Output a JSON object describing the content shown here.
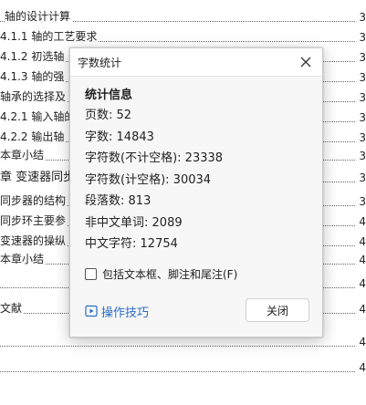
{
  "document": {
    "toc": [
      {
        "text": "轴的设计计算",
        "page": "3"
      },
      {
        "text": "4.1.1 轴的工艺要求",
        "page": "3"
      },
      {
        "text": "4.1.2 初选轴",
        "page": "3"
      },
      {
        "text": "4.1.3 轴的强",
        "page": "3"
      },
      {
        "text": "轴承的选择及",
        "page": "3"
      },
      {
        "text": "4.2.1 输入轴的",
        "page": "3"
      },
      {
        "text": "4.2.2 输出轴",
        "page": "3"
      },
      {
        "text": "本章小结",
        "page": "3"
      },
      {
        "text": "章 变速器同步",
        "page": "3"
      },
      {
        "text": "同步器的结构",
        "page": "3"
      },
      {
        "text": "同步环主要参",
        "page": "4"
      },
      {
        "text": "变速器的操纵",
        "page": "4"
      },
      {
        "text": "本章小结",
        "page": "4"
      },
      {
        "text": "",
        "page": "4"
      },
      {
        "text": "文献",
        "page": "4"
      },
      {
        "text": "",
        "page": "4"
      },
      {
        "text": "",
        "page": "4"
      }
    ]
  },
  "dialog": {
    "title": "字数统计",
    "section_title": "统计信息",
    "stats": [
      {
        "label": "页数:",
        "value": "52"
      },
      {
        "label": "字数:",
        "value": "14843"
      },
      {
        "label": "字符数(不计空格):",
        "value": "23338"
      },
      {
        "label": "字符数(计空格):",
        "value": "30034"
      },
      {
        "label": "段落数:",
        "value": "813"
      },
      {
        "label": "非中文单词:",
        "value": "2089"
      },
      {
        "label": "中文字符:",
        "value": "12754"
      }
    ],
    "checkbox_label": "包括文本框、脚注和尾注(F)",
    "checkbox_checked": false,
    "tips_label": "操作技巧",
    "close_button_label": "关闭"
  },
  "colors": {
    "link": "#2a6cc7",
    "dialog_bg": "#f7f7f7"
  }
}
